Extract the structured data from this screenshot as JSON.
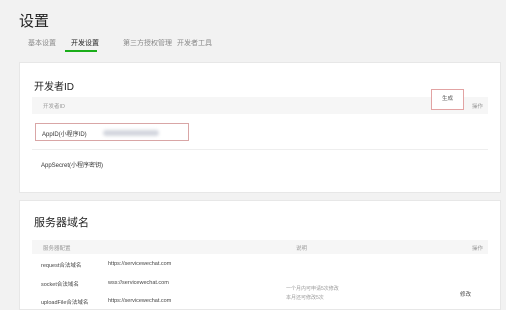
{
  "page": {
    "title": "设置"
  },
  "tabs": [
    {
      "label": "基本设置"
    },
    {
      "label": "开发设置"
    },
    {
      "label": "第三方授权管理"
    },
    {
      "label": "开发者工具"
    }
  ],
  "dev_id": {
    "title": "开发者ID",
    "col_name": "开发者ID",
    "col_action": "操作",
    "appid_label": "AppID(小程序ID)",
    "secret_label": "AppSecret(小程序密钥)",
    "generate_label": "生成"
  },
  "server": {
    "title": "服务器域名",
    "col_config": "服务器配置",
    "col_desc": "说明",
    "col_action": "操作",
    "rows": [
      {
        "name": "request合法域名",
        "value": "https://servicewechat.com"
      },
      {
        "name": "socket合法域名",
        "value": "wss://servicewechat.com"
      },
      {
        "name": "uploadFile合法域名",
        "value": "https://servicewechat.com"
      }
    ],
    "note1": "一个月内可申请5次修改",
    "note2": "本月还可修改5次",
    "edit_label": "修改"
  },
  "colors": {
    "active_tab": "#1aad19",
    "highlight_border": "#d9a6a6"
  }
}
